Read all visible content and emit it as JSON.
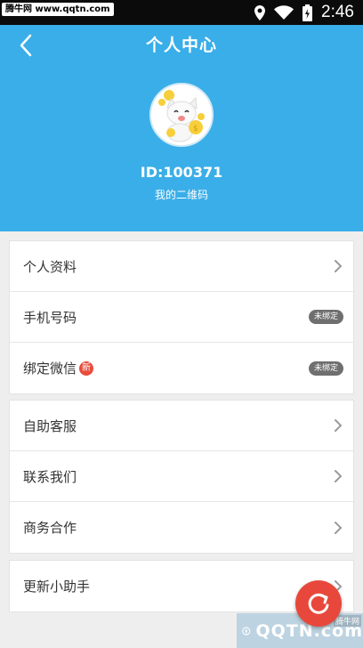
{
  "status_bar": {
    "watermark": "腾牛网 www.qqtn.com",
    "time": "2:46",
    "icons": [
      "location-icon",
      "wifi-icon",
      "battery-icon"
    ]
  },
  "header": {
    "title": "个人中心",
    "back_icon": "back-arrow-icon",
    "background_color": "#3aaee8",
    "user_id": "ID:100371",
    "qr_link": "我的二维码"
  },
  "groups": [
    {
      "rows": [
        {
          "label": "个人资料",
          "right": "chevron"
        },
        {
          "label": "手机号码",
          "right": "pill",
          "pill_text": "未绑定"
        },
        {
          "label": "绑定微信",
          "badge": "新",
          "right": "pill",
          "pill_text": "未绑定"
        }
      ]
    },
    {
      "rows": [
        {
          "label": "自助客服",
          "right": "chevron"
        },
        {
          "label": "联系我们",
          "right": "chevron"
        },
        {
          "label": "商务合作",
          "right": "chevron"
        }
      ]
    },
    {
      "rows": [
        {
          "label": "更新小助手",
          "right": "chevron"
        }
      ]
    }
  ],
  "floating_button": {
    "icon": "refresh-icon",
    "color": "#e8483b"
  },
  "watermark_bottom": {
    "brand": "QQTN.com",
    "site": "腾牛网"
  }
}
